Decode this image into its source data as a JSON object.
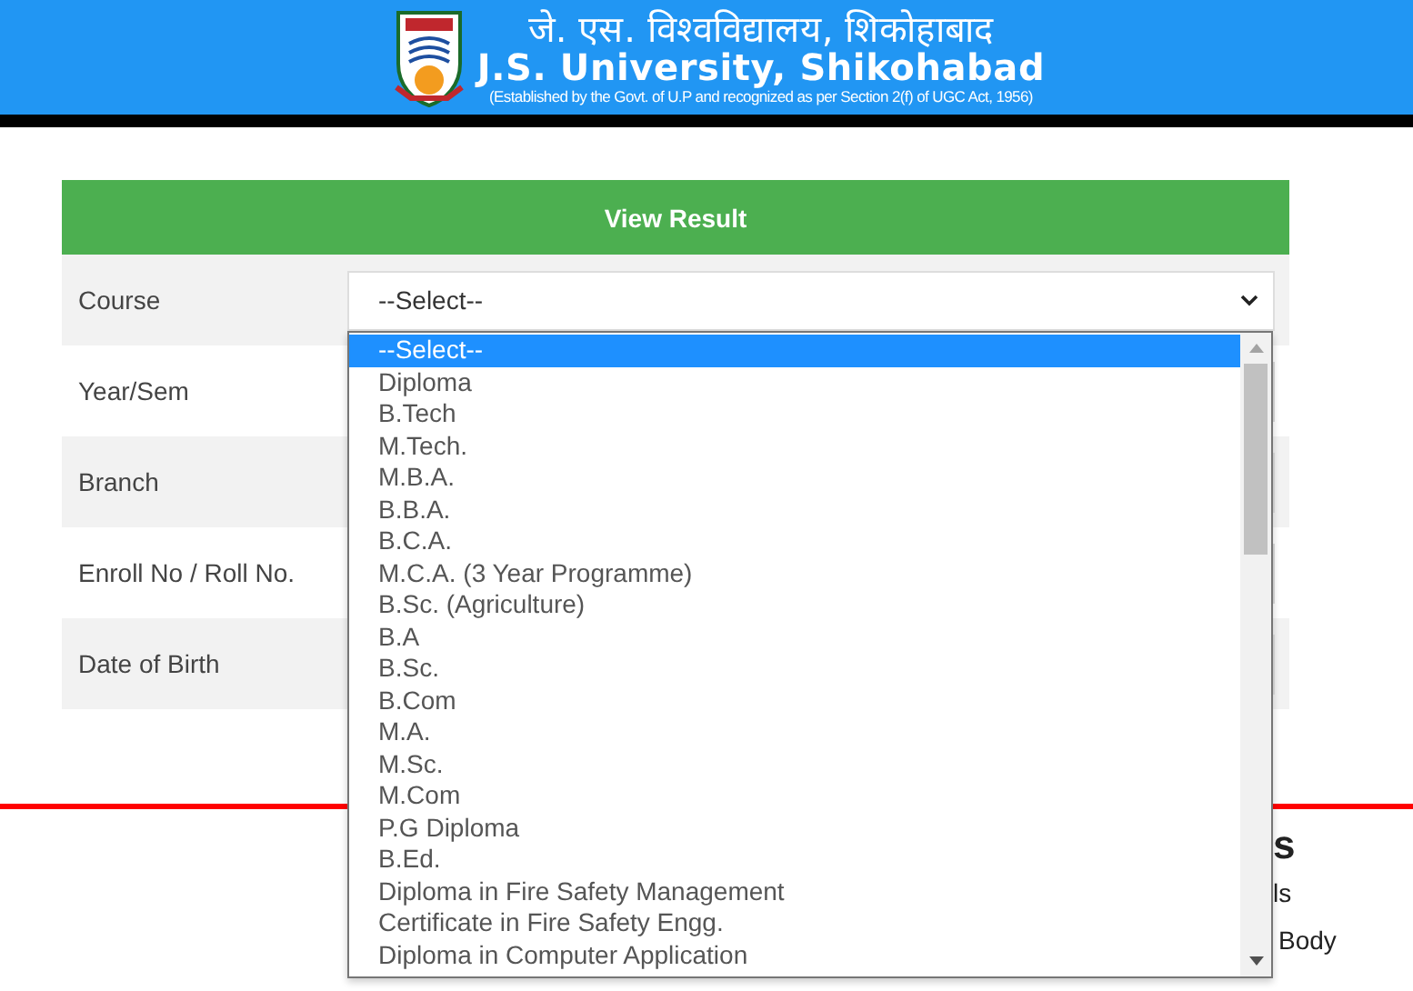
{
  "header": {
    "title_hindi": "जे. एस. विश्वविद्यालय, शिकोहाबाद",
    "title": "J.S. University, Shikohabad",
    "subtitle": "(Established by the Govt. of U.P and recognized as per Section 2(f) of UGC Act, 1956)"
  },
  "form": {
    "heading": "View Result",
    "fields": [
      {
        "label": "Course",
        "value": "--Select--"
      },
      {
        "label": "Year/Sem"
      },
      {
        "label": "Branch"
      },
      {
        "label": "Enroll No / Roll No."
      },
      {
        "label": "Date of Birth"
      }
    ]
  },
  "dropdown": {
    "options": [
      {
        "label": "--Select--",
        "selected": true
      },
      {
        "label": "Diploma",
        "selected": false
      },
      {
        "label": "B.Tech",
        "selected": false
      },
      {
        "label": "M.Tech.",
        "selected": false
      },
      {
        "label": "M.B.A.",
        "selected": false
      },
      {
        "label": "B.B.A.",
        "selected": false
      },
      {
        "label": "B.C.A.",
        "selected": false
      },
      {
        "label": "M.C.A. (3 Year Programme)",
        "selected": false
      },
      {
        "label": "B.Sc. (Agriculture)",
        "selected": false
      },
      {
        "label": "B.A",
        "selected": false
      },
      {
        "label": "B.Sc.",
        "selected": false
      },
      {
        "label": "B.Com",
        "selected": false
      },
      {
        "label": "M.A.",
        "selected": false
      },
      {
        "label": "M.Sc.",
        "selected": false
      },
      {
        "label": "M.Com",
        "selected": false
      },
      {
        "label": "P.G Diploma",
        "selected": false
      },
      {
        "label": "B.Ed.",
        "selected": false
      },
      {
        "label": "Diploma in Fire Safety Management",
        "selected": false
      },
      {
        "label": "Certificate in Fire Safety Engg.",
        "selected": false
      },
      {
        "label": "Diploma in Computer Application",
        "selected": false
      }
    ]
  },
  "footer": {
    "heading": "s",
    "links": [
      "ls",
      "Body"
    ]
  }
}
